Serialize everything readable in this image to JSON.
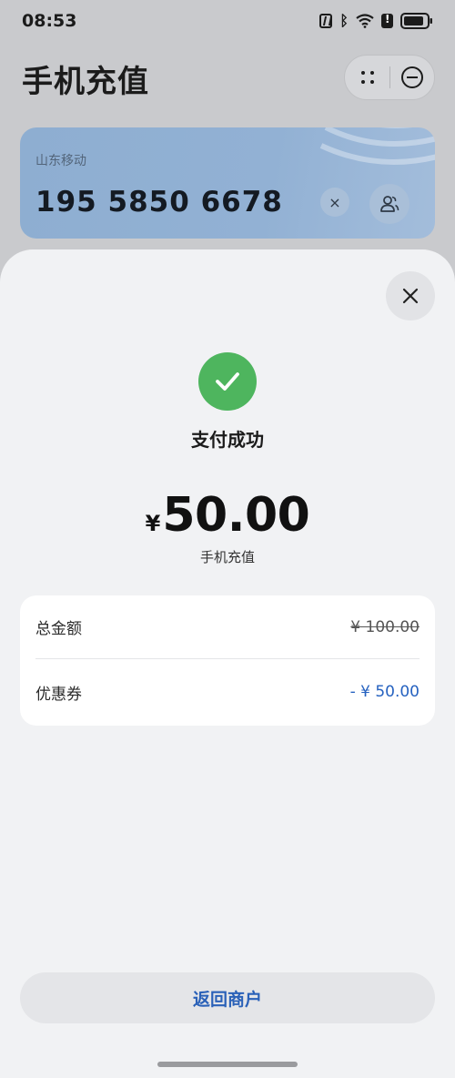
{
  "status_bar": {
    "time": "08:53",
    "icons": [
      "nfc-icon",
      "bluetooth-icon",
      "wifi-icon",
      "data-icon",
      "battery-icon"
    ]
  },
  "header": {
    "title": "手机充值",
    "capsule_icons": [
      "more-dots-icon",
      "minimize-circle-icon"
    ]
  },
  "phone_card": {
    "carrier": "山东移动",
    "number": "195 5850 6678",
    "clear_icon": "×"
  },
  "sheet": {
    "status_text": "支付成功",
    "currency_symbol": "¥",
    "amount": "50.00",
    "amount_caption": "手机充值",
    "details": [
      {
        "label": "总金额",
        "value": "¥ 100.00"
      },
      {
        "label": "优惠券",
        "value": "- ¥ 50.00"
      }
    ],
    "return_button": "返回商户"
  },
  "colors": {
    "success_green": "#4eb55e",
    "accent_blue": "#2662c0",
    "card_blue": "#92b1d4"
  }
}
